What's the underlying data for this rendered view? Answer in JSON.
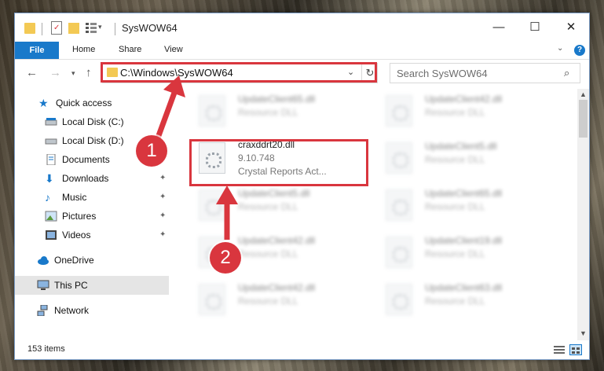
{
  "window": {
    "title": "SysWOW64",
    "controls": {
      "minimize": "—",
      "maximize": "☐",
      "close": "✕"
    }
  },
  "ribbon": {
    "tabs": [
      "File",
      "Home",
      "Share",
      "View"
    ],
    "help": "?"
  },
  "address": {
    "path": "C:\\Windows\\SysWOW64"
  },
  "search": {
    "placeholder": "Search SysWOW64"
  },
  "sidebar": {
    "items": [
      {
        "label": "Quick access",
        "icon": "star-icon"
      },
      {
        "label": "Local Disk (C:)",
        "icon": "drive-icon"
      },
      {
        "label": "Local Disk (D:)",
        "icon": "drive-icon"
      },
      {
        "label": "Documents",
        "icon": "documents-icon"
      },
      {
        "label": "Downloads",
        "icon": "downloads-icon"
      },
      {
        "label": "Music",
        "icon": "music-icon"
      },
      {
        "label": "Pictures",
        "icon": "pictures-icon"
      },
      {
        "label": "Videos",
        "icon": "videos-icon"
      },
      {
        "label": "OneDrive",
        "icon": "cloud-icon"
      },
      {
        "label": "This PC",
        "icon": "computer-icon"
      },
      {
        "label": "Network",
        "icon": "network-icon"
      }
    ]
  },
  "files": {
    "blurred": [
      {
        "name": "UpdateClient65.dll",
        "type": "Resource DLL"
      },
      {
        "name": "UpdateClient42.dll",
        "type": "Resource DLL"
      },
      {
        "name": "UpdateClient5.dll",
        "type": "Resource DLL"
      },
      {
        "name": "UpdateClient5.dll",
        "type": "Resource DLL"
      },
      {
        "name": "UpdateClient65.dll",
        "type": "Resource DLL"
      },
      {
        "name": "UpdateClient42.dll",
        "type": "Resource DLL"
      },
      {
        "name": "UpdateClient19.dll",
        "type": "Resource DLL"
      },
      {
        "name": "UpdateClient42.dll",
        "type": "Resource DLL"
      },
      {
        "name": "UpdateClient63.dll",
        "type": "Resource DLL"
      }
    ],
    "target": {
      "name": "craxddrt20.dll",
      "version": "9.10.748",
      "description": "Crystal Reports Act..."
    }
  },
  "status": {
    "count": "153 items"
  },
  "annotations": {
    "step1": "1",
    "step2": "2",
    "color": "#d9363e"
  }
}
